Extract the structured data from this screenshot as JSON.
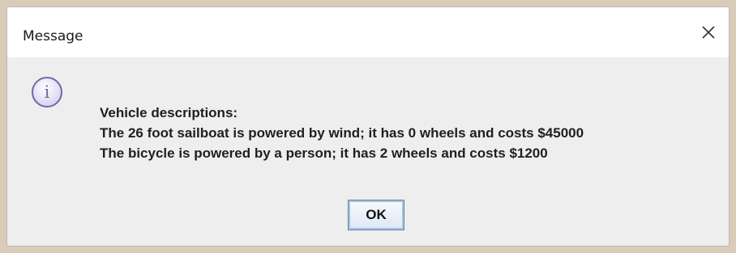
{
  "dialog": {
    "title": "Message",
    "close_icon": "close-icon",
    "message_icon": "information-icon",
    "message_icon_glyph": "i",
    "message_lines": [
      "Vehicle descriptions:",
      "The 26 foot sailboat is powered by wind; it has 0 wheels and costs $45000",
      "The bicycle is powered by a person; it has 2 wheels and costs $1200"
    ],
    "ok_label": "OK"
  },
  "colors": {
    "background": "#d9ccb8",
    "dialog_body": "#eeeeee",
    "titlebar": "#ffffff",
    "icon_fill": "#d8d3ef",
    "icon_stroke": "#6f68a8"
  }
}
